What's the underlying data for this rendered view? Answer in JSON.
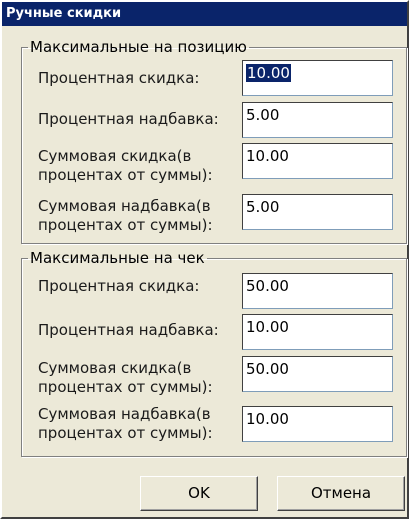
{
  "window": {
    "title": "Ручные скидки"
  },
  "position_group": {
    "legend": "Максимальные на позицию",
    "rows": [
      {
        "label_line1": "Процентная скидка:",
        "label_line2": "",
        "value": "10.00"
      },
      {
        "label_line1": "Процентная надбавка:",
        "label_line2": "",
        "value": "5.00"
      },
      {
        "label_line1": "Суммовая скидка(в",
        "label_line2": "процентах от суммы):",
        "value": "10.00"
      },
      {
        "label_line1": "Суммовая надбавка(в",
        "label_line2": "процентах от суммы):",
        "value": "5.00"
      }
    ]
  },
  "check_group": {
    "legend": "Максимальные на чек",
    "rows": [
      {
        "label_line1": "Процентная скидка:",
        "label_line2": "",
        "value": "50.00"
      },
      {
        "label_line1": "Процентная надбавка:",
        "label_line2": "",
        "value": "10.00"
      },
      {
        "label_line1": "Суммовая скидка(в",
        "label_line2": "процентах от суммы):",
        "value": "50.00"
      },
      {
        "label_line1": "Суммовая надбавка(в",
        "label_line2": "процентах от суммы):",
        "value": "10.00"
      }
    ]
  },
  "buttons": {
    "ok": "OK",
    "cancel": "Отмена"
  }
}
